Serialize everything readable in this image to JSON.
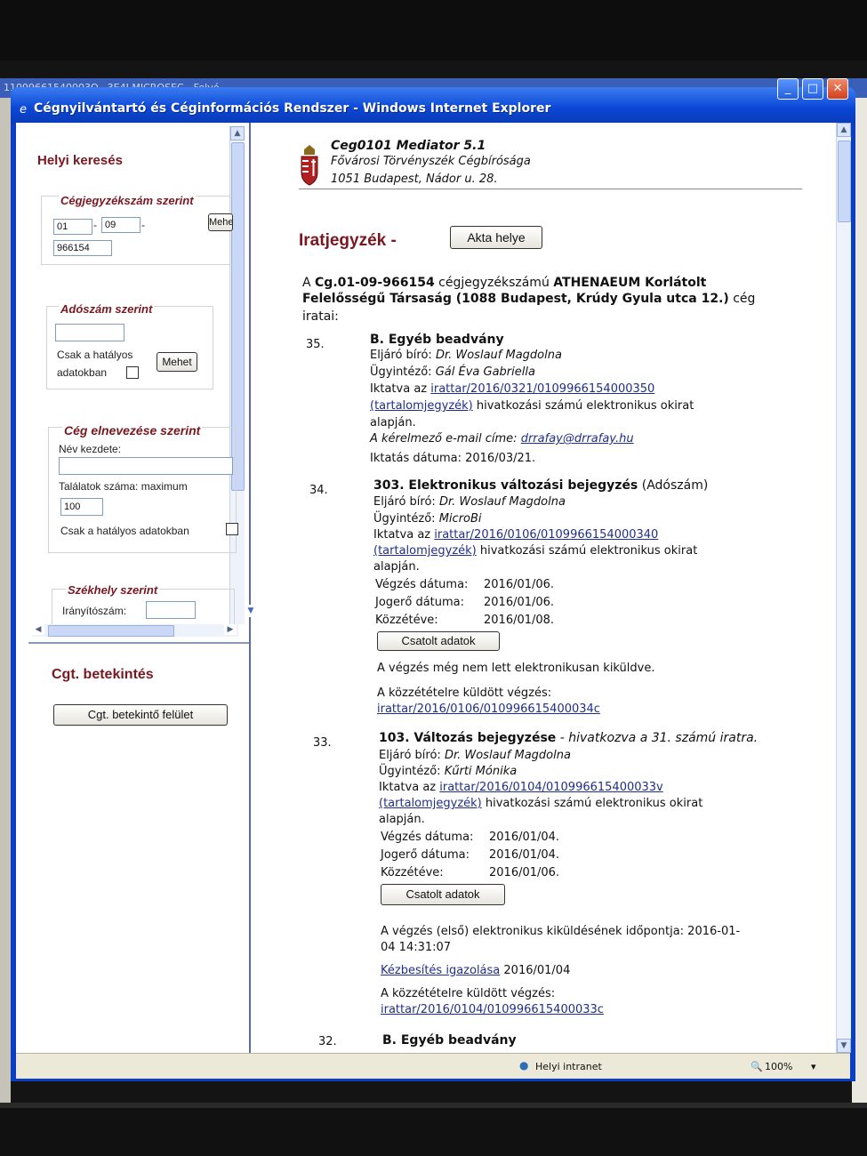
{
  "background_window": {
    "title": "11099661540003O...3E4J   MICROSEC - Felvé"
  },
  "window": {
    "title": "Cégnyilvántartó és Céginformációs Rendszer - Windows Internet Explorer"
  },
  "left_panel": {
    "heading": "Helyi keresés",
    "by_regnum": {
      "legend": "Cégjegyzékszám szerint",
      "part1": "01",
      "part2": "09",
      "part3": "966154",
      "button": "Mehet"
    },
    "by_tax": {
      "legend": "Adószám szerint",
      "only_valid_line1": "Csak a hatályos",
      "only_valid_line2": "adatokban",
      "button": "Mehet"
    },
    "by_name": {
      "legend": "Cég elnevezése szerint",
      "name_label": "Név kezdete:",
      "max_label": "Találatok száma: maximum",
      "max_value": "100",
      "only_valid": "Csak a hatályos adatokban"
    },
    "by_seat": {
      "legend": "Székhely szerint",
      "zip_label": "Irányítószám:"
    },
    "cgt": {
      "heading": "Cgt. betekintés",
      "button": "Cgt. betekintő felület"
    }
  },
  "header": {
    "app": "Ceg0101 Mediator 5.1",
    "court": "Fővárosi Törvényszék Cégbírósága",
    "address": "1051 Budapest, Nádor u. 28."
  },
  "page": {
    "title": "Iratjegyzék -",
    "akta_button": "Akta helye",
    "intro_prefix": "A",
    "intro_regnum": "Cg.01-09-966154",
    "intro_mid": "cégjegyzékszámú",
    "intro_company1": "ATHENAEUM Korlátolt",
    "intro_company2": "Felelősségű Társaság (1088 Budapest, Krúdy Gyula utca 12.)",
    "intro_end": "cég",
    "intro_line3": "iratai:"
  },
  "entries": {
    "e35": {
      "num": "35.",
      "title": "B. Egyéb beadvány",
      "judge_label": "Eljáró bíró:",
      "judge": "Dr. Woslauf Magdolna",
      "clerk_label": "Ügyintéző:",
      "clerk": "Gál Éva Gabriella",
      "filed_label": "Iktatva az",
      "filed_link": "irattar/2016/0321/0109966154000350",
      "toc": "(tartalomjegyzék)",
      "ref_text": "hivatkozási számú elektronikus okirat",
      "basis": "alapján.",
      "email_label": "A kérelmező e-mail címe:",
      "email": "drrafay@drrafay.hu",
      "date_label": "Iktatás dátuma:",
      "date": "2016/03/21."
    },
    "e34": {
      "num": "34.",
      "title": "303. Elektronikus változási bejegyzés",
      "title_suffix": "(Adószám)",
      "judge_label": "Eljáró bíró:",
      "judge": "Dr. Woslauf Magdolna",
      "clerk_label": "Ügyintéző:",
      "clerk": "MicroBi",
      "filed_label": "Iktatva az",
      "filed_link": "irattar/2016/0106/0109966154000340",
      "toc": "(tartalomjegyzék)",
      "ref_text": "hivatkozási számú elektronikus okirat",
      "basis": "alapján.",
      "order_label": "Végzés dátuma:",
      "order": "2016/01/06.",
      "final_label": "Jogerő dátuma:",
      "final": "2016/01/06.",
      "pub_label": "Közzétéve:",
      "pub": "2016/01/08.",
      "attached_button": "Csatolt adatok",
      "not_sent": "A végzés még nem lett elektronikusan kiküldve.",
      "sent_label": "A közzétételre küldött végzés:",
      "sent_link": "irattar/2016/0106/010996615400034c"
    },
    "e33": {
      "num": "33.",
      "title": "103. Változás bejegyzése",
      "title_suffix": "- hivatkozva a 31. számú iratra.",
      "judge_label": "Eljáró bíró:",
      "judge": "Dr. Woslauf Magdolna",
      "clerk_label": "Ügyintéző:",
      "clerk": "Kűrti Mónika",
      "filed_label": "Iktatva az",
      "filed_link": "irattar/2016/0104/010996615400033v",
      "toc": "(tartalomjegyzék)",
      "ref_text": "hivatkozási számú elektronikus okirat",
      "basis": "alapján.",
      "order_label": "Végzés dátuma:",
      "order": "2016/01/04.",
      "final_label": "Jogerő dátuma:",
      "final": "2016/01/04.",
      "pub_label": "Közzétéve:",
      "pub": "2016/01/06.",
      "attached_button": "Csatolt adatok",
      "first_sent_1": "A végzés (első) elektronikus kiküldésének időpontja: 2016-01-",
      "first_sent_2": "04 14:31:07",
      "delivery_link": "Kézbesítés igazolása",
      "delivery_date": "2016/01/04",
      "sent_label": "A közzétételre küldött végzés:",
      "sent_link": "irattar/2016/0104/010996615400033c"
    },
    "e32": {
      "num": "32.",
      "title": "B. Egyéb beadvány"
    }
  },
  "statusbar": {
    "zone": "Helyi intranet",
    "zoom": "100%"
  },
  "icons": [
    "ie-icon",
    "minimize-icon",
    "maximize-icon",
    "close-icon",
    "crest-icon",
    "scroll-up-icon",
    "scroll-down-icon",
    "scroll-left-icon",
    "scroll-right-icon",
    "intranet-icon",
    "zoom-icon"
  ],
  "colors": {
    "titlebar": "#0b47d6",
    "heading": "#7a1720",
    "link": "#1f2e8c"
  }
}
